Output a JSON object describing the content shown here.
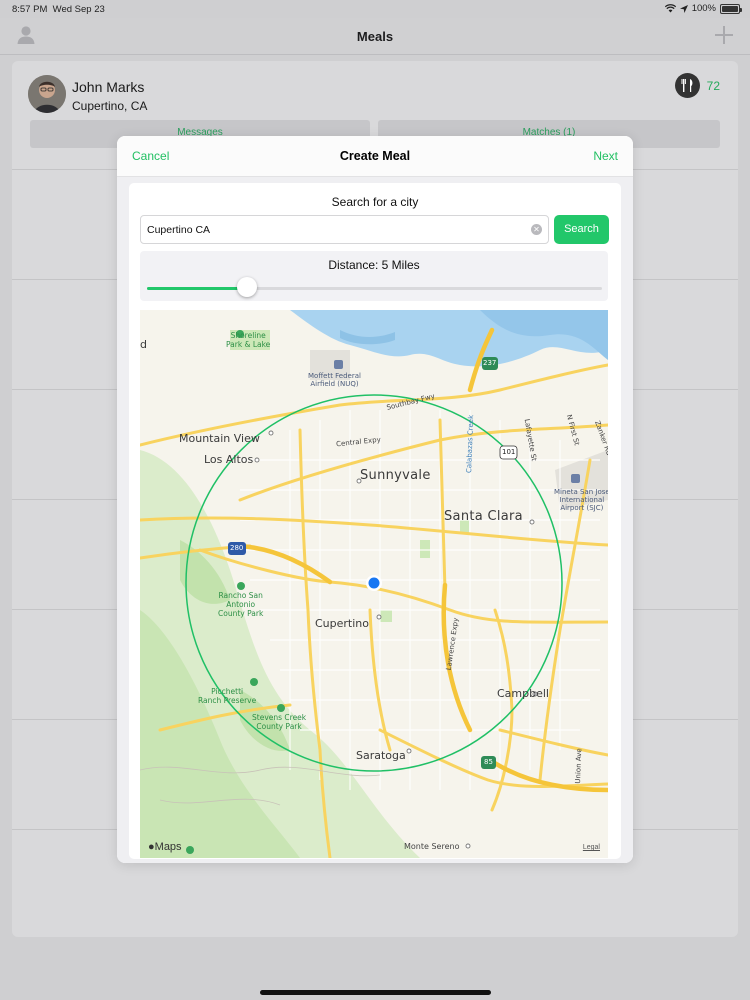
{
  "status_bar": {
    "time": "8:57 PM",
    "date": "Wed Sep 23",
    "battery": "100%"
  },
  "nav": {
    "title": "Meals",
    "left_icon": "person-icon",
    "right_icon": "plus-icon"
  },
  "profile": {
    "name": "John Marks",
    "location": "Cupertino, CA",
    "meal_count": "72"
  },
  "tabs": [
    {
      "label": "Messages"
    },
    {
      "label": "Matches (1)"
    }
  ],
  "modal": {
    "cancel_label": "Cancel",
    "title": "Create Meal",
    "next_label": "Next",
    "search_heading": "Search for a city",
    "search_value": "Cupertino CA",
    "search_button": "Search",
    "distance_label": "Distance: 5 Miles",
    "slider_fraction": 0.22
  },
  "map": {
    "labels": {
      "mountain_view": "Mountain View",
      "los_altos": "Los Altos",
      "sunnyvale": "Sunnyvale",
      "santa_clara": "Santa Clara",
      "cupertino": "Cupertino",
      "campbell": "Campbell",
      "saratoga": "Saratoga",
      "monte_sereno": "Monte Sereno",
      "shoreline": "Shoreline\nPark & Lake",
      "moffett": "Moffett Federal\nAirfield (NUQ)",
      "mineta": "Mineta San Jose\nInternational\nAirport (SJC)",
      "rancho": "Rancho San\nAntonio\nCounty Park",
      "picchetti": "Picchetti\nRanch Preserve",
      "stevens_creek": "Stevens Creek\nCounty Park",
      "southbay": "Southbay Fwy",
      "central_expy": "Central Expy",
      "lawrence_expy": "Lawrence Expy",
      "calabazas": "Calabazas Creek",
      "lafayette": "Lafayette St",
      "n_first": "N First St",
      "zanker": "Zanker Rd",
      "union_ave": "Union Ave",
      "edge_d": "d",
      "hwy_237": "237",
      "hwy_101": "101",
      "hwy_280": "280",
      "hwy_85": "85"
    },
    "maps_logo": "Maps",
    "legal": "Legal"
  },
  "colors": {
    "accent": "#22c76a",
    "road": "#f8d35f",
    "water": "#a9d3f0",
    "park": "#c9e7b5"
  }
}
